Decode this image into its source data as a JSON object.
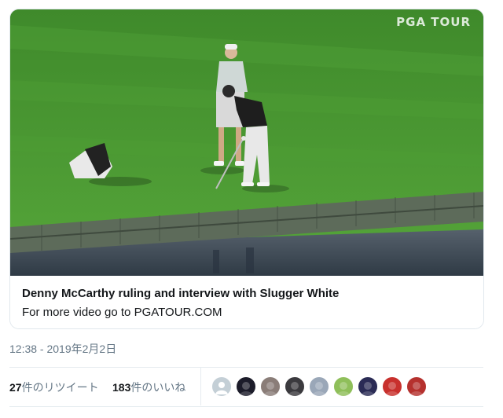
{
  "card": {
    "watermark": "PGA TOUR",
    "title": "Denny McCarthy ruling and interview with Slugger White",
    "description": "For more video go to PGATOUR.COM"
  },
  "tweet": {
    "timestamp": "12:38 - 2019年2月2日"
  },
  "stats": {
    "retweets_count": "27",
    "retweets_label": "件のリツイート",
    "likes_count": "183",
    "likes_label": "件のいいね"
  },
  "avatars": [
    {
      "icon": "default-profile-icon",
      "color": "#c4cfd6"
    },
    {
      "icon": "profile-photo",
      "color": "#1c1c2a"
    },
    {
      "icon": "profile-photo",
      "color": "#8a7d78"
    },
    {
      "icon": "profile-photo",
      "color": "#3b3a3e"
    },
    {
      "icon": "profile-photo",
      "color": "#9aa7b8"
    },
    {
      "icon": "profile-photo",
      "color": "#8fbf5a"
    },
    {
      "icon": "profile-photo",
      "color": "#2a2b55"
    },
    {
      "icon": "profile-photo",
      "color": "#c8302d"
    },
    {
      "icon": "profile-photo",
      "color": "#b5312e"
    }
  ],
  "colors": {
    "text_primary": "#14171a",
    "text_secondary": "#657786",
    "border": "#e1e8ed",
    "grass": "#4a9a32",
    "water": "#3d4a57"
  }
}
